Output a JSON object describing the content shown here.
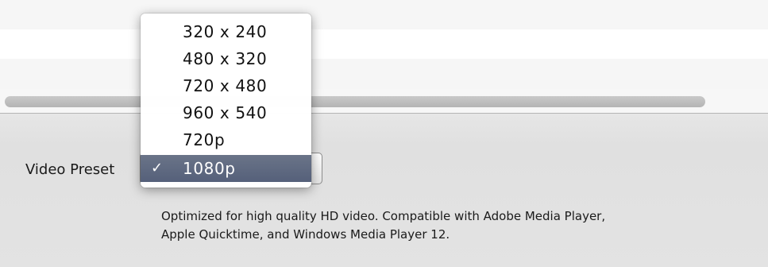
{
  "form": {
    "preset_label": "Video Preset",
    "description_line1": "Optimized for high quality HD video. Compatible with Adobe Media Player,",
    "description_line2": "Apple Quicktime, and Windows Media Player 12."
  },
  "dropdown": {
    "options": [
      "320 x 240",
      "480 x 320",
      "720 x 480",
      "960 x 540",
      "720p",
      "1080p"
    ],
    "selected_value": "1080p",
    "check_glyph": "✓"
  },
  "colors": {
    "selection": "#5f6a82",
    "panel_background": "#e4e4e4"
  },
  "icons": {
    "checkmark": "check-icon"
  }
}
